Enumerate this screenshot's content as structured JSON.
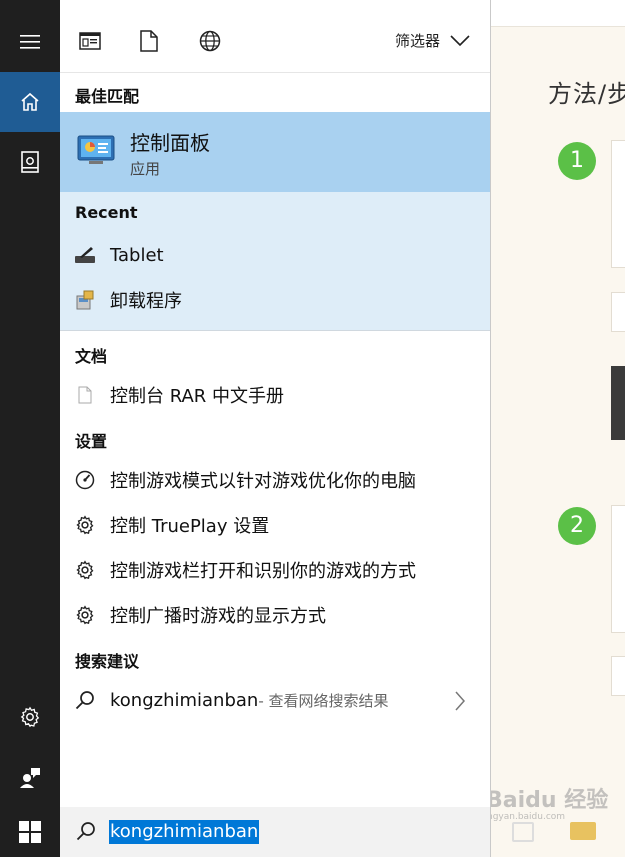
{
  "background_page": {
    "heading": "方法/步",
    "steps": [
      "1",
      "2"
    ],
    "watermark": "Baidu 经验",
    "watermark_sub": "jingyan.baidu.com"
  },
  "toolbar": {
    "filter_label": "筛选器",
    "icons": [
      "apps-icon",
      "document-icon",
      "web-icon",
      "chevron-down-icon"
    ]
  },
  "best_match": {
    "heading": "最佳匹配",
    "title": "控制面板",
    "subtitle": "应用",
    "icon": "control-panel-icon"
  },
  "recent": {
    "heading": "Recent",
    "items": [
      {
        "label": "Tablet",
        "icon": "tablet-pen-icon"
      },
      {
        "label": "卸载程序",
        "icon": "uninstall-icon"
      }
    ]
  },
  "documents": {
    "heading": "文档",
    "items": [
      {
        "label": "控制台 RAR 中文手册",
        "icon": "document-icon"
      }
    ]
  },
  "settings": {
    "heading": "设置",
    "items": [
      {
        "label": "控制游戏模式以针对游戏优化你的电脑",
        "icon": "game-mode-icon"
      },
      {
        "label": "控制 TruePlay 设置",
        "icon": "gear-icon"
      },
      {
        "label": "控制游戏栏打开和识别你的游戏的方式",
        "icon": "gear-icon"
      },
      {
        "label": "控制广播时游戏的显示方式",
        "icon": "gear-icon"
      }
    ]
  },
  "suggestions": {
    "heading": "搜索建议",
    "items": [
      {
        "label": "kongzhimianban",
        "suffix": " - 查看网络搜索结果",
        "icon": "search-icon"
      }
    ]
  },
  "search": {
    "value": "kongzhimianban"
  },
  "colors": {
    "rail": "#1f1f1f",
    "rail_active": "#1f5c94",
    "best_match_bg": "#a9d1f0",
    "recent_bg": "#deedf8",
    "selection": "#0078d7",
    "step_badge": "#5bc047"
  }
}
